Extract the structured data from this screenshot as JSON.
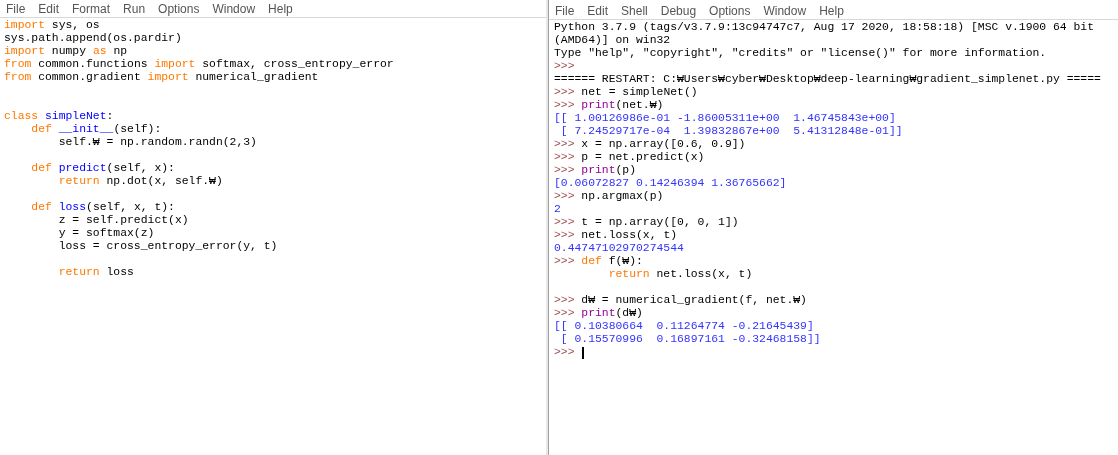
{
  "editor": {
    "menu": [
      "File",
      "Edit",
      "Format",
      "Run",
      "Options",
      "Window",
      "Help"
    ],
    "lines": [
      {
        "kind": "code",
        "segments": [
          {
            "kind": "keyword",
            "text": "import"
          },
          {
            "kind": "plain",
            "text": " sys, os"
          }
        ]
      },
      {
        "kind": "code",
        "segments": [
          {
            "kind": "plain",
            "text": "sys.path.append(os.pardir)"
          }
        ]
      },
      {
        "kind": "code",
        "segments": [
          {
            "kind": "keyword",
            "text": "import"
          },
          {
            "kind": "plain",
            "text": " numpy "
          },
          {
            "kind": "keyword",
            "text": "as"
          },
          {
            "kind": "plain",
            "text": " np"
          }
        ]
      },
      {
        "kind": "code",
        "segments": [
          {
            "kind": "keyword",
            "text": "from"
          },
          {
            "kind": "plain",
            "text": " common.functions "
          },
          {
            "kind": "keyword",
            "text": "import"
          },
          {
            "kind": "plain",
            "text": " softmax, cross_entropy_error"
          }
        ]
      },
      {
        "kind": "code",
        "segments": [
          {
            "kind": "keyword",
            "text": "from"
          },
          {
            "kind": "plain",
            "text": " common.gradient "
          },
          {
            "kind": "keyword",
            "text": "import"
          },
          {
            "kind": "plain",
            "text": " numerical_gradient"
          }
        ]
      },
      {
        "kind": "blank"
      },
      {
        "kind": "blank"
      },
      {
        "kind": "code",
        "segments": [
          {
            "kind": "keyword",
            "text": "class"
          },
          {
            "kind": "name",
            "text": " simpleNet"
          },
          {
            "kind": "plain",
            "text": ":"
          }
        ]
      },
      {
        "kind": "code",
        "segments": [
          {
            "kind": "keyword",
            "text": "    def"
          },
          {
            "kind": "name",
            "text": " __init__"
          },
          {
            "kind": "plain",
            "text": "(self):"
          }
        ]
      },
      {
        "kind": "code",
        "segments": [
          {
            "kind": "plain",
            "text": "        self.₩ = np.random.randn(2,3)"
          }
        ]
      },
      {
        "kind": "blank"
      },
      {
        "kind": "code",
        "segments": [
          {
            "kind": "keyword",
            "text": "    def"
          },
          {
            "kind": "name",
            "text": " predict"
          },
          {
            "kind": "plain",
            "text": "(self, x):"
          }
        ]
      },
      {
        "kind": "code",
        "segments": [
          {
            "kind": "keyword",
            "text": "        return"
          },
          {
            "kind": "plain",
            "text": " np.dot(x, self.₩)"
          }
        ]
      },
      {
        "kind": "blank"
      },
      {
        "kind": "code",
        "segments": [
          {
            "kind": "keyword",
            "text": "    def"
          },
          {
            "kind": "name",
            "text": " loss"
          },
          {
            "kind": "plain",
            "text": "(self, x, t):"
          }
        ]
      },
      {
        "kind": "code",
        "segments": [
          {
            "kind": "plain",
            "text": "        z = self.predict(x)"
          }
        ]
      },
      {
        "kind": "code",
        "segments": [
          {
            "kind": "plain",
            "text": "        y = softmax(z)"
          }
        ]
      },
      {
        "kind": "code",
        "segments": [
          {
            "kind": "plain",
            "text": "        loss = cross_entropy_error(y, t)"
          }
        ]
      },
      {
        "kind": "blank"
      },
      {
        "kind": "code",
        "segments": [
          {
            "kind": "keyword",
            "text": "        return"
          },
          {
            "kind": "plain",
            "text": " loss"
          }
        ]
      }
    ]
  },
  "shell": {
    "menu": [
      "File",
      "Edit",
      "Shell",
      "Debug",
      "Options",
      "Window",
      "Help"
    ],
    "lines": [
      {
        "kind": "code",
        "segments": [
          {
            "kind": "plain",
            "text": "Python 3.7.9 (tags/v3.7.9:13c94747c7, Aug 17 2020, 18:58:18) [MSC v.1900 64 bit"
          }
        ]
      },
      {
        "kind": "code",
        "segments": [
          {
            "kind": "plain",
            "text": "(AMD64)] on win32"
          }
        ]
      },
      {
        "kind": "code",
        "segments": [
          {
            "kind": "plain",
            "text": "Type \"help\", \"copyright\", \"credits\" or \"license()\" for more information."
          }
        ]
      },
      {
        "kind": "code",
        "segments": [
          {
            "kind": "prompt",
            "text": ">>>"
          }
        ]
      },
      {
        "kind": "code",
        "segments": [
          {
            "kind": "plain",
            "text": "====== RESTART: C:₩Users₩cyber₩Desktop₩deep-learning₩gradient_simplenet.py ====="
          }
        ]
      },
      {
        "kind": "code",
        "segments": [
          {
            "kind": "prompt",
            "text": ">>>"
          },
          {
            "kind": "plain",
            "text": " net = simpleNet()"
          }
        ]
      },
      {
        "kind": "code",
        "segments": [
          {
            "kind": "prompt",
            "text": ">>>"
          },
          {
            "kind": "builtin",
            "text": " print"
          },
          {
            "kind": "plain",
            "text": "(net.₩)"
          }
        ]
      },
      {
        "kind": "code",
        "segments": [
          {
            "kind": "output",
            "text": "[[ 1.00126986e-01 -1.86005311e+00  1.46745843e+00]"
          }
        ]
      },
      {
        "kind": "code",
        "segments": [
          {
            "kind": "output",
            "text": " [ 7.24529717e-04  1.39832867e+00  5.41312848e-01]]"
          }
        ]
      },
      {
        "kind": "code",
        "segments": [
          {
            "kind": "prompt",
            "text": ">>>"
          },
          {
            "kind": "plain",
            "text": " x = np.array([0.6, 0.9])"
          }
        ]
      },
      {
        "kind": "code",
        "segments": [
          {
            "kind": "prompt",
            "text": ">>>"
          },
          {
            "kind": "plain",
            "text": " p = net.predict(x)"
          }
        ]
      },
      {
        "kind": "code",
        "segments": [
          {
            "kind": "prompt",
            "text": ">>>"
          },
          {
            "kind": "builtin",
            "text": " print"
          },
          {
            "kind": "plain",
            "text": "(p)"
          }
        ]
      },
      {
        "kind": "code",
        "segments": [
          {
            "kind": "output",
            "text": "[0.06072827 0.14246394 1.36765662]"
          }
        ]
      },
      {
        "kind": "code",
        "segments": [
          {
            "kind": "prompt",
            "text": ">>>"
          },
          {
            "kind": "plain",
            "text": " np.argmax(p)"
          }
        ]
      },
      {
        "kind": "code",
        "segments": [
          {
            "kind": "output",
            "text": "2"
          }
        ]
      },
      {
        "kind": "code",
        "segments": [
          {
            "kind": "prompt",
            "text": ">>>"
          },
          {
            "kind": "plain",
            "text": " t = np.array([0, 0, 1])"
          }
        ]
      },
      {
        "kind": "code",
        "segments": [
          {
            "kind": "prompt",
            "text": ">>>"
          },
          {
            "kind": "plain",
            "text": " net.loss(x, t)"
          }
        ]
      },
      {
        "kind": "code",
        "segments": [
          {
            "kind": "output",
            "text": "0.44747102970274544"
          }
        ]
      },
      {
        "kind": "code",
        "segments": [
          {
            "kind": "prompt",
            "text": ">>>"
          },
          {
            "kind": "keyword",
            "text": " def"
          },
          {
            "kind": "plain",
            "text": " f(₩):"
          }
        ]
      },
      {
        "kind": "code",
        "segments": [
          {
            "kind": "keyword",
            "text": "        return"
          },
          {
            "kind": "plain",
            "text": " net.loss(x, t)"
          }
        ]
      },
      {
        "kind": "blank"
      },
      {
        "kind": "code",
        "segments": [
          {
            "kind": "prompt",
            "text": ">>>"
          },
          {
            "kind": "plain",
            "text": " d₩ = numerical_gradient(f, net.₩)"
          }
        ]
      },
      {
        "kind": "code",
        "segments": [
          {
            "kind": "prompt",
            "text": ">>>"
          },
          {
            "kind": "builtin",
            "text": " print"
          },
          {
            "kind": "plain",
            "text": "(d₩)"
          }
        ]
      },
      {
        "kind": "code",
        "segments": [
          {
            "kind": "output",
            "text": "[[ 0.10380664  0.11264774 -0.21645439]"
          }
        ]
      },
      {
        "kind": "code",
        "segments": [
          {
            "kind": "output",
            "text": " [ 0.15570996  0.16897161 -0.32468158]]"
          }
        ]
      },
      {
        "kind": "code",
        "segments": [
          {
            "kind": "prompt",
            "text": ">>>"
          }
        ],
        "cursor": true
      }
    ]
  }
}
